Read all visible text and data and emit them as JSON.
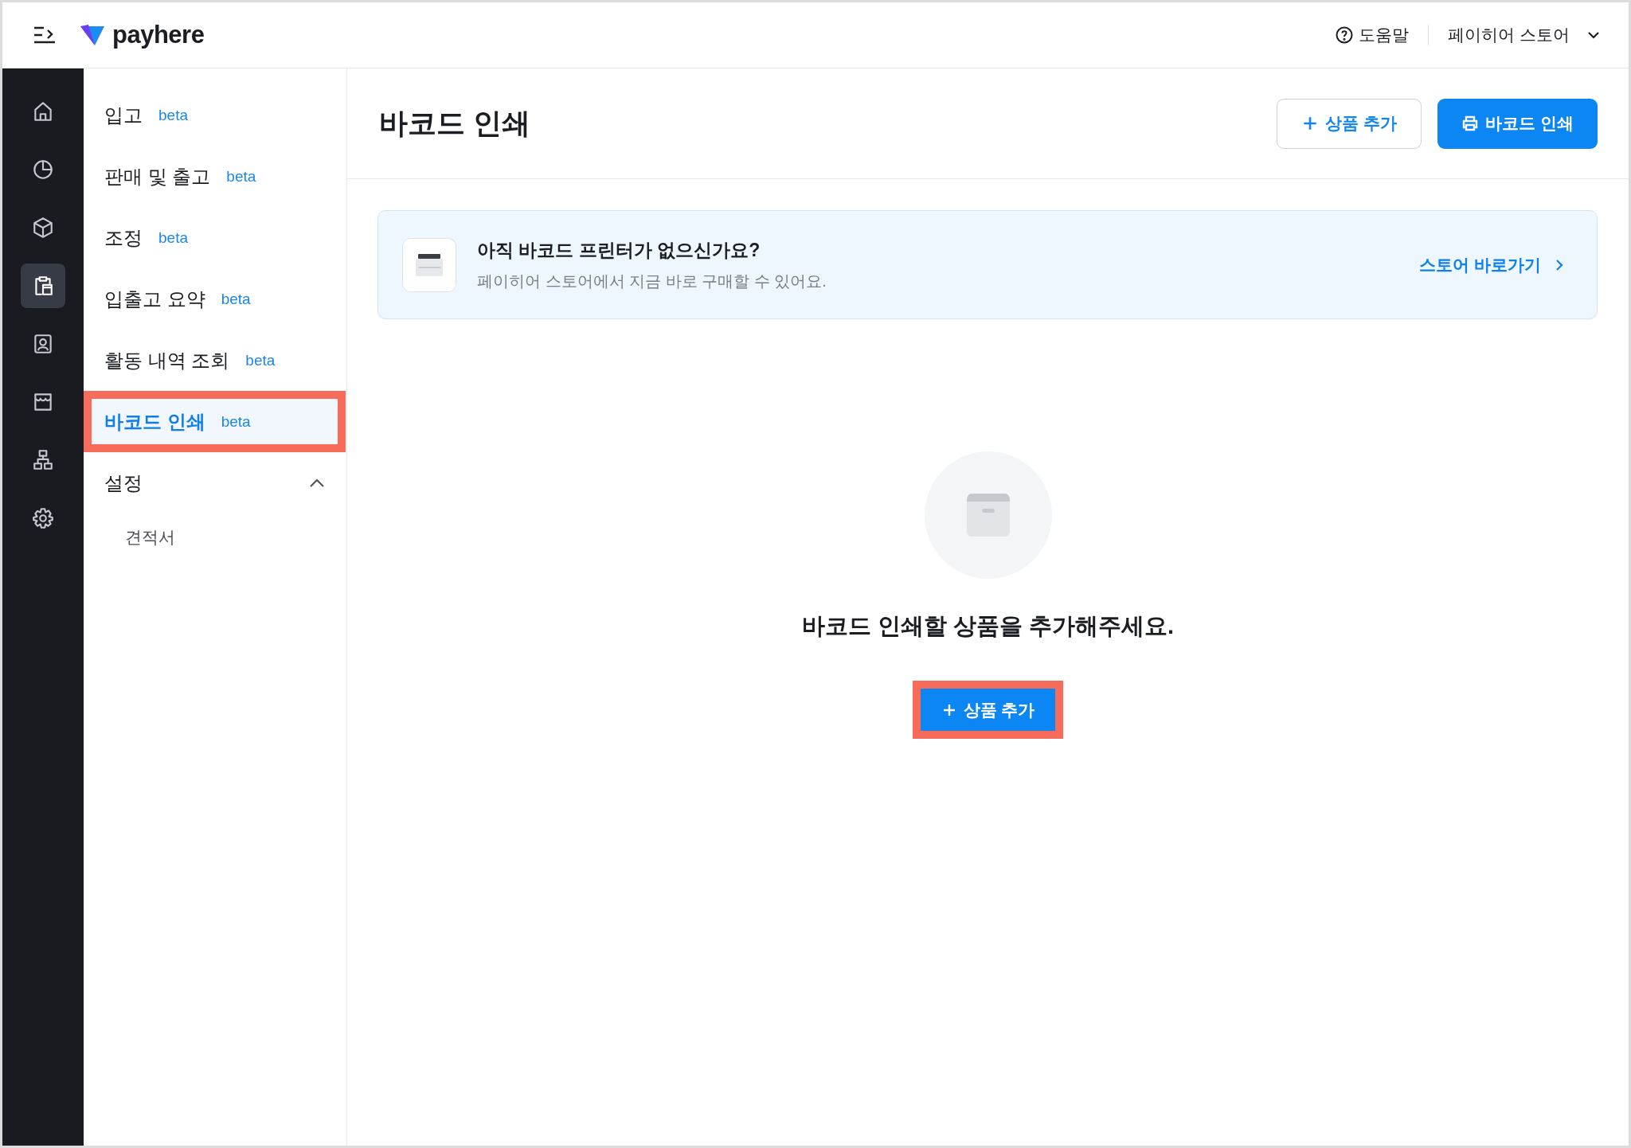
{
  "topbar": {
    "logo": "payhere",
    "help": "도움말",
    "store": "페이히어 스토어"
  },
  "rail": [
    {
      "kind": "home",
      "selected": false
    },
    {
      "kind": "chart",
      "selected": false
    },
    {
      "kind": "box",
      "selected": false
    },
    {
      "kind": "clipboard",
      "selected": true
    },
    {
      "kind": "contact",
      "selected": false
    },
    {
      "kind": "store",
      "selected": false
    },
    {
      "kind": "hierarchy",
      "selected": false
    },
    {
      "kind": "settings",
      "selected": false
    }
  ],
  "nav": {
    "items": [
      {
        "label": "입고",
        "badge": "beta",
        "selected": false,
        "highlighted": false
      },
      {
        "label": "판매 및 출고",
        "badge": "beta",
        "selected": false,
        "highlighted": false
      },
      {
        "label": "조정",
        "badge": "beta",
        "selected": false,
        "highlighted": false
      },
      {
        "label": "입출고 요약",
        "badge": "beta",
        "selected": false,
        "highlighted": false
      },
      {
        "label": "활동 내역 조회",
        "badge": "beta",
        "selected": false,
        "highlighted": false
      },
      {
        "label": "바코드 인쇄",
        "badge": "beta",
        "selected": true,
        "highlighted": true
      }
    ],
    "group": {
      "label": "설정",
      "expanded": true,
      "children": [
        {
          "label": "견적서"
        }
      ]
    }
  },
  "page": {
    "title": "바코드 인쇄",
    "actions": [
      {
        "label": "상품 추가",
        "kind": "outline"
      },
      {
        "label": "바코드 인쇄",
        "kind": "primary"
      }
    ],
    "banner": {
      "title": "아직 바코드 프린터가 없으신가요?",
      "text": "페이히어 스토어에서 지금 바로 구매할 수 있어요.",
      "link": "스토어 바로가기"
    },
    "empty": {
      "message": "바코드 인쇄할 상품을 추가해주세요.",
      "button": {
        "label": "상품 추가",
        "highlighted": true
      }
    }
  }
}
